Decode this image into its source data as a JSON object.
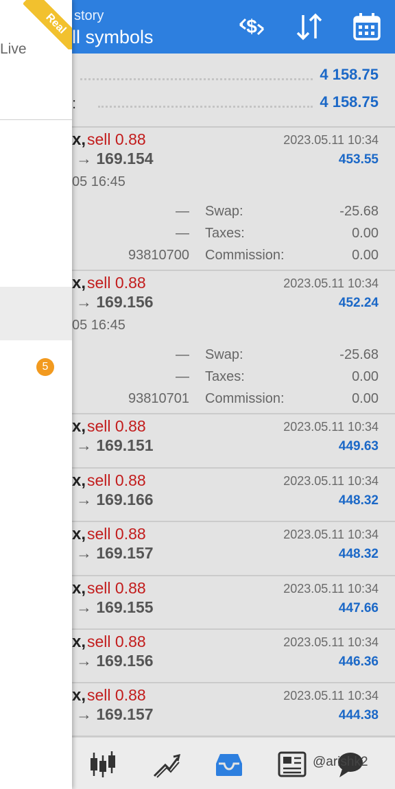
{
  "header": {
    "subtitle": "story",
    "title": "ll symbols",
    "icons": [
      "currency-exchange-icon",
      "sort-icon",
      "calendar-icon"
    ]
  },
  "summary": {
    "rows": [
      {
        "label": "",
        "value": "4 158.75"
      },
      {
        "label": ":",
        "value": "4 158.75"
      }
    ]
  },
  "deals": [
    {
      "symbol": "x,",
      "side": "sell 0.88",
      "arrow": "→",
      "price": "169.154",
      "time": "2023.05.11 10:34",
      "profit": "453.55",
      "open_time": "05 16:45",
      "details": [
        {
          "c1": "—",
          "c2": "Swap:",
          "c3": "-25.68"
        },
        {
          "c1": "—",
          "c2": "Taxes:",
          "c3": "0.00"
        },
        {
          "c1": "93810700",
          "c2": "Commission:",
          "c3": "0.00"
        }
      ]
    },
    {
      "symbol": "x,",
      "side": "sell 0.88",
      "arrow": "→",
      "price": "169.156",
      "time": "2023.05.11 10:34",
      "profit": "452.24",
      "open_time": "05 16:45",
      "details": [
        {
          "c1": "—",
          "c2": "Swap:",
          "c3": "-25.68"
        },
        {
          "c1": "—",
          "c2": "Taxes:",
          "c3": "0.00"
        },
        {
          "c1": "93810701",
          "c2": "Commission:",
          "c3": "0.00"
        }
      ]
    },
    {
      "symbol": "x,",
      "side": "sell 0.88",
      "arrow": "→",
      "price": "169.151",
      "time": "2023.05.11 10:34",
      "profit": "449.63"
    },
    {
      "symbol": "x,",
      "side": "sell 0.88",
      "arrow": "→",
      "price": "169.166",
      "time": "2023.05.11 10:34",
      "profit": "448.32"
    },
    {
      "symbol": "x,",
      "side": "sell 0.88",
      "arrow": "→",
      "price": "169.157",
      "time": "2023.05.11 10:34",
      "profit": "448.32"
    },
    {
      "symbol": "x,",
      "side": "sell 0.88",
      "arrow": "→",
      "price": "169.155",
      "time": "2023.05.11 10:34",
      "profit": "447.66"
    },
    {
      "symbol": "x,",
      "side": "sell 0.88",
      "arrow": "→",
      "price": "169.156",
      "time": "2023.05.11 10:34",
      "profit": "446.36"
    },
    {
      "symbol": "x,",
      "side": "sell 0.88",
      "arrow": "→",
      "price": "169.157",
      "time": "2023.05.11 10:34",
      "profit": "444.38"
    }
  ],
  "drawer": {
    "account_type": "Live",
    "ribbon": "Real",
    "badge_count": "5"
  },
  "bottom_nav": {
    "items": [
      "quotes-icon",
      "chart-icon",
      "history-icon",
      "news-icon",
      "chat-icon"
    ],
    "active": "history-icon"
  },
  "watermark": "@arishk2",
  "colors": {
    "header_bg": "#2d7fdf",
    "sell": "#c21c1c",
    "profit": "#1b68c7",
    "ribbon": "#f2c12e",
    "badge": "#f29a1f"
  }
}
